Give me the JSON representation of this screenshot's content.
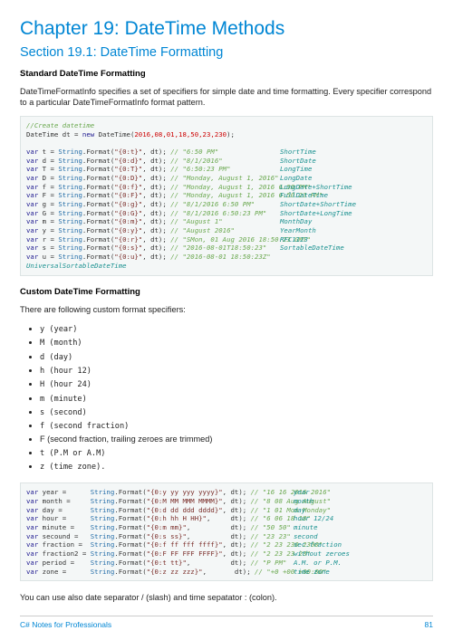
{
  "chapter_title": "Chapter 19: DateTime Methods",
  "section_title": "Section 19.1: DateTime Formatting",
  "h3_standard": "Standard DateTime Formatting",
  "p_intro": "DateTimeFormatInfo specifies a set of specifiers for simple date and time formatting. Every specifier correspond to a particular DateTimeFormatInfo format pattern.",
  "h3_custom": "Custom DateTime Formatting",
  "p_custom_intro": "There are following custom format specifiers:",
  "bullets": {
    "b0": "y (year)",
    "b1": "M (month)",
    "b2": "d (day)",
    "b3": "h (hour 12)",
    "b4": "H (hour 24)",
    "b5": "m (minute)",
    "b6": "s (second)",
    "b7": "f (second fraction)",
    "b8": "F (second fraction, trailing zeroes are trimmed)",
    "b9": "t (P.M or A.M)",
    "b10": "z (time zone)."
  },
  "p_sep": "You can use also date separator / (slash) and time sepatator : (colon).",
  "footer_left": "C# Notes for Professionals",
  "footer_right": "81",
  "code1": {
    "c0": "//Create datetime",
    "dt_kw": "new",
    "dt_typ": "DateTime",
    "dt_nums": "2016,08,01,18,50,23,230",
    "l1v": "var",
    "l1n": " t = ",
    "l1s": "String",
    "l1f": ".Format(",
    "l1q": "\"{0:t}\"",
    "l1d": ", dt); ",
    "l1c": "// \"6:50 PM\"",
    "l1t": "ShortTime",
    "l2v": "var",
    "l2n": " d = ",
    "l2s": "String",
    "l2f": ".Format(",
    "l2q": "\"{0:d}\"",
    "l2d": ", dt); ",
    "l2c": "// \"8/1/2016\"",
    "l2t": "ShortDate",
    "l3v": "var",
    "l3n": " T = ",
    "l3s": "String",
    "l3f": ".Format(",
    "l3q": "\"{0:T}\"",
    "l3d": ", dt); ",
    "l3c": "// \"6:50:23 PM\"",
    "l3t": "LongTime",
    "l4v": "var",
    "l4n": " D = ",
    "l4s": "String",
    "l4f": ".Format(",
    "l4q": "\"{0:D}\"",
    "l4d": ", dt); ",
    "l4c": "// \"Monday, August 1, 2016\"",
    "l4t": "LongDate",
    "l5v": "var",
    "l5n": " f = ",
    "l5s": "String",
    "l5f": ".Format(",
    "l5q": "\"{0:f}\"",
    "l5d": ", dt); ",
    "l5c": "// \"Monday, August 1, 2016 6:50 PM\"",
    "l5t": "LongDate+ShortTime",
    "l6v": "var",
    "l6n": " F = ",
    "l6s": "String",
    "l6f": ".Format(",
    "l6q": "\"{0:F}\"",
    "l6d": ", dt); ",
    "l6c": "// \"Monday, August 1, 2016 6:50:23 PM\"",
    "l6t": "FullDateTime",
    "l7v": "var",
    "l7n": " g = ",
    "l7s": "String",
    "l7f": ".Format(",
    "l7q": "\"{0:g}\"",
    "l7d": ", dt); ",
    "l7c": "// \"8/1/2016 6:50 PM\"",
    "l7t": "ShortDate+ShortTime",
    "l8v": "var",
    "l8n": " G = ",
    "l8s": "String",
    "l8f": ".Format(",
    "l8q": "\"{0:G}\"",
    "l8d": ", dt); ",
    "l8c": "// \"8/1/2016 6:50:23 PM\"",
    "l8t": "ShortDate+LongTime",
    "l9v": "var",
    "l9n": " m = ",
    "l9s": "String",
    "l9f": ".Format(",
    "l9q": "\"{0:m}\"",
    "l9d": ", dt); ",
    "l9c": "// \"August 1\"",
    "l9t": "MonthDay",
    "l10v": "var",
    "l10n": " y = ",
    "l10s": "String",
    "l10f": ".Format(",
    "l10q": "\"{0:y}\"",
    "l10d": ", dt); ",
    "l10c": "// \"August 2016\"",
    "l10t": "YearMonth",
    "l11v": "var",
    "l11n": " r = ",
    "l11s": "String",
    "l11f": ".Format(",
    "l11q": "\"{0:r}\"",
    "l11d": ", dt); ",
    "l11c": "// \"SMon, 01 Aug 2016 18:50:23 GMT\"",
    "l11t": "RFC1123",
    "l12v": "var",
    "l12n": " s = ",
    "l12s": "String",
    "l12f": ".Format(",
    "l12q": "\"{0:s}\"",
    "l12d": ", dt); ",
    "l12c": "// \"2016-08-01T18:50:23\"",
    "l12t": "SortableDateTime",
    "l13v": "var",
    "l13n": " u = ",
    "l13s": "String",
    "l13f": ".Format(",
    "l13q": "\"{0:u}\"",
    "l13d": ", dt); ",
    "l13c": "// \"2016-08-01 18:50:23Z\"",
    "l13t": "UniversalSortableDateTime"
  },
  "code2": {
    "r1v": "var",
    "r1n": " year =      ",
    "r1s": "String",
    "r1f": ".Format(",
    "r1q": "\"{0:y yy yyy yyyy}\"",
    "r1d": ", dt); ",
    "r1c": "// \"16 16 2016 2016\"",
    "r1t": "year",
    "r2v": "var",
    "r2n": " month =     ",
    "r2s": "String",
    "r2f": ".Format(",
    "r2q": "\"{0:M MM MMM MMMM}\"",
    "r2d": ", dt); ",
    "r2c": "// \"8 08 Aug August\"",
    "r2t": "month",
    "r3v": "var",
    "r3n": " day =       ",
    "r3s": "String",
    "r3f": ".Format(",
    "r3q": "\"{0:d dd ddd dddd}\"",
    "r3d": ", dt); ",
    "r3c": "// \"1 01 Mon Monday\"",
    "r3t": "day",
    "r4v": "var",
    "r4n": " hour =      ",
    "r4s": "String",
    "r4f": ".Format(",
    "r4q": "\"{0:h hh H HH}\"",
    "r4d": ",     dt); ",
    "r4c": "// \"6 06 18 18\"",
    "r4t": "hour 12/24",
    "r5v": "var",
    "r5n": " minute =    ",
    "r5s": "String",
    "r5f": ".Format(",
    "r5q": "\"{0:m mm}\"",
    "r5d": ",          dt); ",
    "r5c": "// \"50 50\"",
    "r5t": "minute",
    "r6v": "var",
    "r6n": " secound =   ",
    "r6s": "String",
    "r6f": ".Format(",
    "r6q": "\"{0:s ss}\"",
    "r6d": ",          dt); ",
    "r6c": "// \"23 23\"",
    "r6t": "second",
    "r7v": "var",
    "r7n": " fraction =  ",
    "r7s": "String",
    "r7f": ".Format(",
    "r7q": "\"{0:f ff fff ffff}\"",
    "r7d": ", dt); ",
    "r7c": "// \"2 23 230 2300\"",
    "r7t": "sec.fraction",
    "r8v": "var",
    "r8n": " fraction2 = ",
    "r8s": "String",
    "r8f": ".Format(",
    "r8q": "\"{0:F FF FFF FFFF}\"",
    "r8d": ", dt); ",
    "r8c": "// \"2 23 23 23\"",
    "r8t": "without zeroes",
    "r9v": "var",
    "r9n": " period =    ",
    "r9s": "String",
    "r9f": ".Format(",
    "r9q": "\"{0:t tt}\"",
    "r9d": ",          dt); ",
    "r9c": "// \"P PM\"",
    "r9t": "A.M. or P.M.",
    "r10v": "var",
    "r10n": " zone =      ",
    "r10s": "String",
    "r10f": ".Format(",
    "r10q": "\"{0:z zz zzz}\"",
    "r10d": ",       dt); ",
    "r10c": "// \"+0 +00 +00:00\"",
    "r10t": "time zone"
  }
}
